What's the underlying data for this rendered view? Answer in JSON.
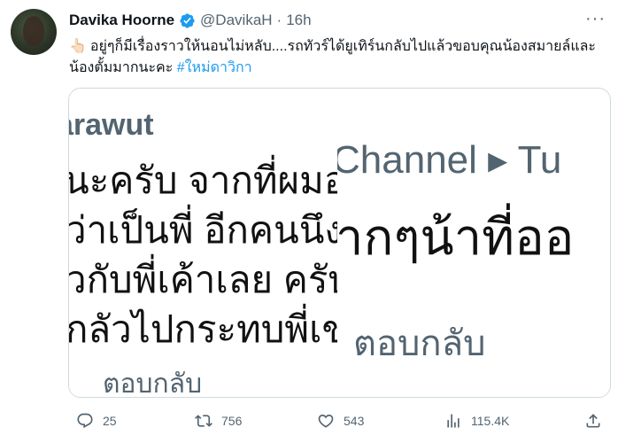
{
  "author": {
    "display_name": "Davika Hoorne",
    "handle": "@DavikaH",
    "separator": "·",
    "time": "16h"
  },
  "tweet": {
    "emoji": "👆🏻",
    "text": "อยู่ๆก็มีเรื่องราวให้นอนไม่หลับ....รถทัวร์ได้ยูเทิร์นกลับไปแล้วขอบคุณน้องสมายล์และน้องตั้มมากนะคะ",
    "hashtag": "#ใหม่ดาวิกา"
  },
  "media": {
    "left": {
      "name": "arawut",
      "lines": [
        "นะครับ จากที่ผมอ่",
        "ว่าเป็นพี่ อีกคนนึง",
        "วกับพี่เค้าเลย ครับ",
        "กลัวไปกระทบพี่เข"
      ],
      "reply_label": "ตอบกลับ"
    },
    "right": {
      "channel_text": "Channel ▸ Tu",
      "line": "ากๆน้าที่ออ",
      "reply_label": "ตอบกลับ"
    }
  },
  "actions": {
    "reply_count": "25",
    "retweet_count": "756",
    "like_count": "543",
    "view_count": "115.4K"
  },
  "colors": {
    "accent": "#1d9bf0",
    "muted": "#536471",
    "border": "#cfd9de"
  }
}
